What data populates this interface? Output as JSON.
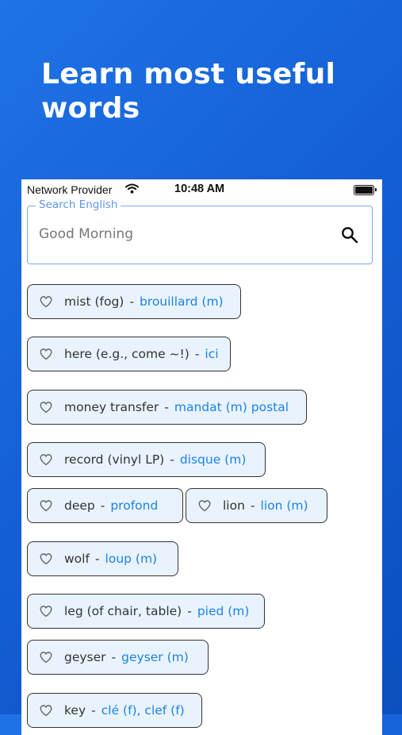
{
  "headline": "Learn most useful words",
  "status_bar": {
    "carrier": "Network Provider",
    "time": "10:48 AM"
  },
  "search": {
    "label": "Search English",
    "placeholder": "Good Morning"
  },
  "words": [
    {
      "en": "mist (fog)",
      "fr": "brouillard (m)"
    },
    {
      "en": "here (e.g., come ~!)",
      "fr": "ici"
    },
    {
      "en": "money transfer",
      "fr": "mandat (m) postal"
    },
    {
      "en": "record (vinyl LP)",
      "fr": "disque (m)"
    },
    {
      "en": "deep",
      "fr": "profond"
    },
    {
      "en": "lion",
      "fr": "lion (m)"
    },
    {
      "en": "wolf",
      "fr": "loup (m)"
    },
    {
      "en": "leg (of chair, table)",
      "fr": "pied (m)"
    },
    {
      "en": "geyser",
      "fr": "geyser (m)"
    },
    {
      "en": "key",
      "fr": "clé (f), clef (f)"
    }
  ],
  "separator": "-",
  "colors": {
    "accent": "#1b82e8",
    "chip_bg": "#e9f3fd",
    "background": "#1560d6"
  },
  "icons": {
    "search": "search-icon",
    "favorite": "heart-outline-icon",
    "wifi": "wifi-icon",
    "battery": "battery-icon"
  }
}
